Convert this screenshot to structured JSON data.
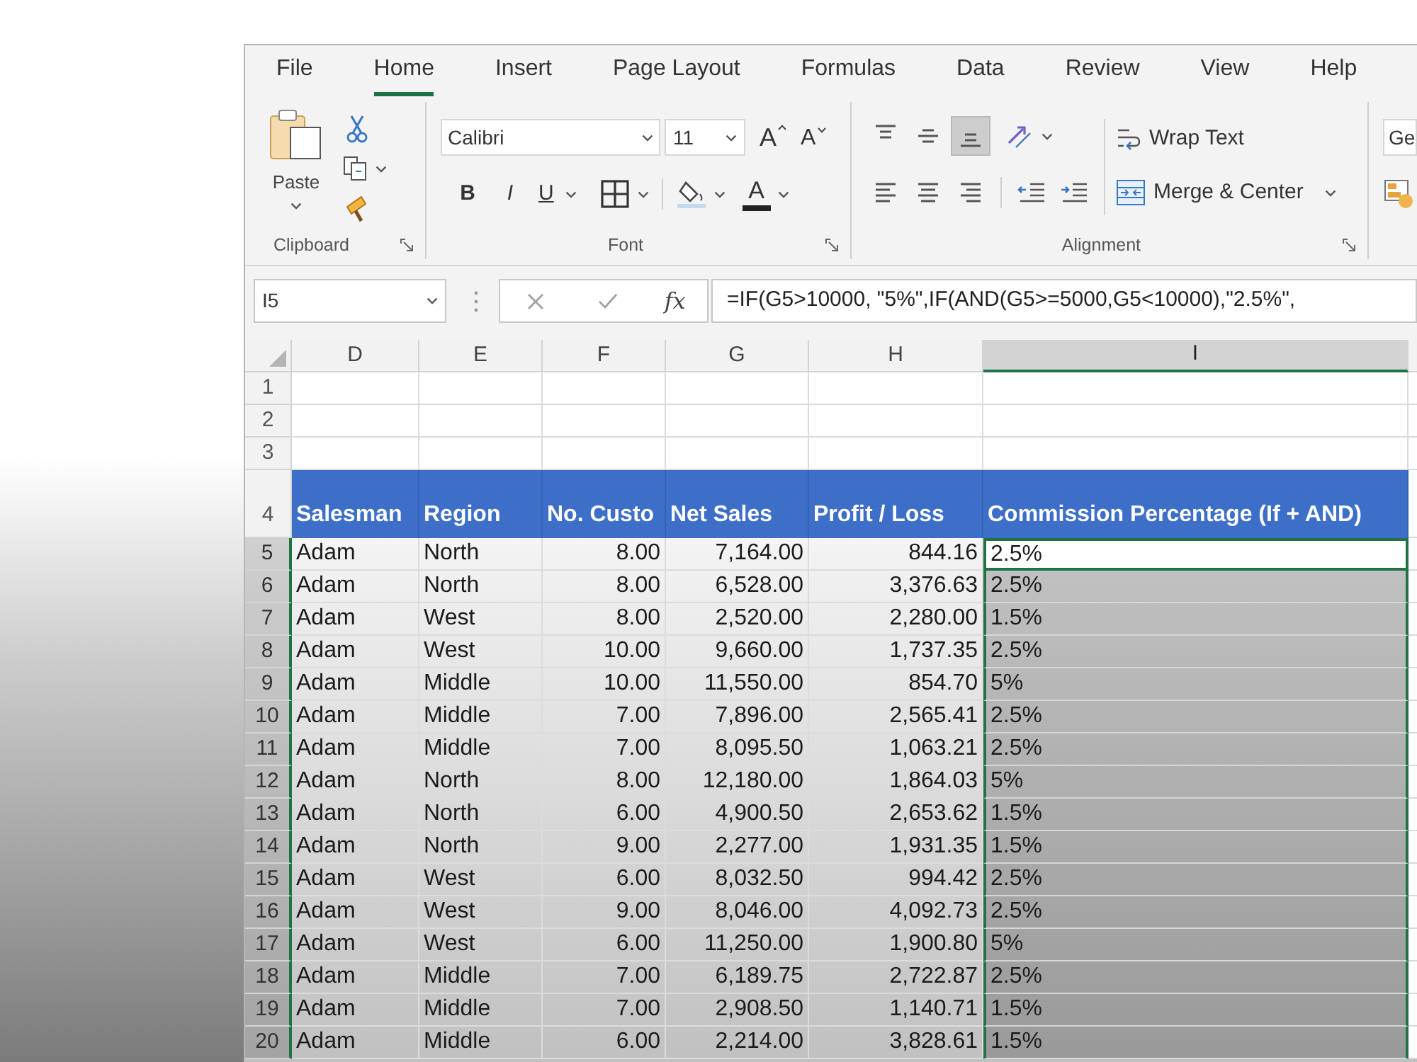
{
  "ribbon_tabs": [
    {
      "label": "File",
      "selected": false
    },
    {
      "label": "Home",
      "selected": true
    },
    {
      "label": "Insert",
      "selected": false
    },
    {
      "label": "Page Layout",
      "selected": false
    },
    {
      "label": "Formulas",
      "selected": false
    },
    {
      "label": "Data",
      "selected": false
    },
    {
      "label": "Review",
      "selected": false
    },
    {
      "label": "View",
      "selected": false
    },
    {
      "label": "Help",
      "selected": false
    }
  ],
  "clipboard": {
    "paste": "Paste",
    "label": "Clipboard"
  },
  "font": {
    "name": "Calibri",
    "size": "11",
    "grow": "A",
    "shrink": "A",
    "bold": "B",
    "italic": "I",
    "underline": "U",
    "font_color": "A",
    "label": "Font"
  },
  "alignment": {
    "vertical": [
      {
        "kind": "top",
        "selected": false
      },
      {
        "kind": "middle",
        "selected": false
      },
      {
        "kind": "bottom",
        "selected": true
      }
    ],
    "horizontal": [
      {
        "kind": "left",
        "selected": false
      },
      {
        "kind": "center",
        "selected": false
      },
      {
        "kind": "right",
        "selected": false
      }
    ],
    "wrap_text": "Wrap Text",
    "merge": "Merge & Center",
    "label": "Alignment"
  },
  "number": {
    "format": "Ge"
  },
  "formula_bar": {
    "name_box": "I5",
    "function_button": "fx",
    "formula": "=IF(G5>10000, \"5%\",IF(AND(G5>=5000,G5<10000),\"2.5%\","
  },
  "sheet": {
    "columns": [
      {
        "label": "D",
        "selected": false
      },
      {
        "label": "E",
        "selected": false
      },
      {
        "label": "F",
        "selected": false
      },
      {
        "label": "G",
        "selected": false
      },
      {
        "label": "H",
        "selected": false
      },
      {
        "label": "I",
        "selected": true
      }
    ],
    "rows": [
      {
        "number": "1",
        "kind": "blank",
        "selected": false,
        "active": false
      },
      {
        "number": "2",
        "kind": "blank",
        "selected": false,
        "active": false
      },
      {
        "number": "3",
        "kind": "blank",
        "selected": false,
        "active": false
      },
      {
        "number": "4",
        "kind": "header",
        "selected": false,
        "active": false,
        "cells": [
          "Salesman",
          "Region",
          "No. Custo",
          "Net Sales",
          "Profit / Loss",
          "Commission Percentage (If + AND)"
        ]
      },
      {
        "number": "5",
        "kind": "data",
        "selected": true,
        "active": true,
        "cells": [
          "Adam",
          "North",
          "8.00",
          "7,164.00",
          "844.16",
          "2.5%"
        ]
      },
      {
        "number": "6",
        "kind": "data",
        "selected": true,
        "active": false,
        "cells": [
          "Adam",
          "North",
          "8.00",
          "6,528.00",
          "3,376.63",
          "2.5%"
        ]
      },
      {
        "number": "7",
        "kind": "data",
        "selected": true,
        "active": false,
        "cells": [
          "Adam",
          "West",
          "8.00",
          "2,520.00",
          "2,280.00",
          "1.5%"
        ]
      },
      {
        "number": "8",
        "kind": "data",
        "selected": true,
        "active": false,
        "cells": [
          "Adam",
          "West",
          "10.00",
          "9,660.00",
          "1,737.35",
          "2.5%"
        ]
      },
      {
        "number": "9",
        "kind": "data",
        "selected": true,
        "active": false,
        "cells": [
          "Adam",
          "Middle",
          "10.00",
          "11,550.00",
          "854.70",
          "5%"
        ]
      },
      {
        "number": "10",
        "kind": "data",
        "selected": true,
        "active": false,
        "cells": [
          "Adam",
          "Middle",
          "7.00",
          "7,896.00",
          "2,565.41",
          "2.5%"
        ]
      },
      {
        "number": "11",
        "kind": "data",
        "selected": true,
        "active": false,
        "cells": [
          "Adam",
          "Middle",
          "7.00",
          "8,095.50",
          "1,063.21",
          "2.5%"
        ]
      },
      {
        "number": "12",
        "kind": "data",
        "selected": true,
        "active": false,
        "cells": [
          "Adam",
          "North",
          "8.00",
          "12,180.00",
          "1,864.03",
          "5%"
        ]
      },
      {
        "number": "13",
        "kind": "data",
        "selected": true,
        "active": false,
        "cells": [
          "Adam",
          "North",
          "6.00",
          "4,900.50",
          "2,653.62",
          "1.5%"
        ]
      },
      {
        "number": "14",
        "kind": "data",
        "selected": true,
        "active": false,
        "cells": [
          "Adam",
          "North",
          "9.00",
          "2,277.00",
          "1,931.35",
          "1.5%"
        ]
      },
      {
        "number": "15",
        "kind": "data",
        "selected": true,
        "active": false,
        "cells": [
          "Adam",
          "West",
          "6.00",
          "8,032.50",
          "994.42",
          "2.5%"
        ]
      },
      {
        "number": "16",
        "kind": "data",
        "selected": true,
        "active": false,
        "cells": [
          "Adam",
          "West",
          "9.00",
          "8,046.00",
          "4,092.73",
          "2.5%"
        ]
      },
      {
        "number": "17",
        "kind": "data",
        "selected": true,
        "active": false,
        "cells": [
          "Adam",
          "West",
          "6.00",
          "11,250.00",
          "1,900.80",
          "5%"
        ]
      },
      {
        "number": "18",
        "kind": "data",
        "selected": true,
        "active": false,
        "cells": [
          "Adam",
          "Middle",
          "7.00",
          "6,189.75",
          "2,722.87",
          "2.5%"
        ]
      },
      {
        "number": "19",
        "kind": "data",
        "selected": true,
        "active": false,
        "cells": [
          "Adam",
          "Middle",
          "7.00",
          "2,908.50",
          "1,140.71",
          "1.5%"
        ]
      },
      {
        "number": "20",
        "kind": "data",
        "selected": true,
        "active": false,
        "cells": [
          "Adam",
          "Middle",
          "6.00",
          "2,214.00",
          "3,828.61",
          "1.5%"
        ]
      }
    ]
  }
}
